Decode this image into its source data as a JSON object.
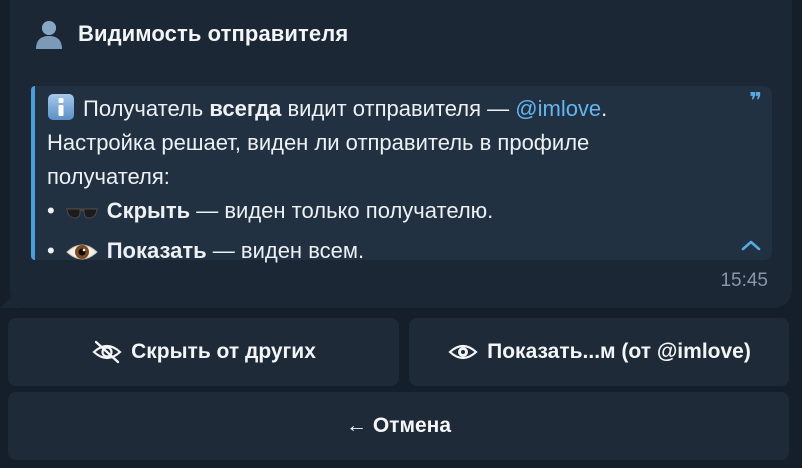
{
  "message": {
    "title": "Видимость отправителя",
    "title_icon": "person-silhouette-icon",
    "quote": {
      "line1_pre": "Получатель ",
      "line1_bold": "всегда",
      "line1_mid": " видит отправителя — ",
      "line1_mention": "@imlove",
      "line1_end": ".",
      "line2": "Настройка решает, виден ли отправитель в профиле",
      "line3": "получателя:",
      "bullet1_bold": "Скрыть",
      "bullet1_rest": " — виден только получателю.",
      "bullet2_bold": "Показать",
      "bullet2_rest": " — виден всем.",
      "bullet_char": "•"
    },
    "time": "15:45"
  },
  "keyboard": {
    "hide_label": "Скрыть от других",
    "show_label": "Показать...м (от @imlove)",
    "cancel_label": "← Отмена"
  },
  "colors": {
    "background": "#151f2b",
    "bubble": "#1b2735",
    "quote_bg": "#223142",
    "accent": "#4a9fd8",
    "mention": "#64b5f0",
    "button_bg": "#1e2a38"
  }
}
